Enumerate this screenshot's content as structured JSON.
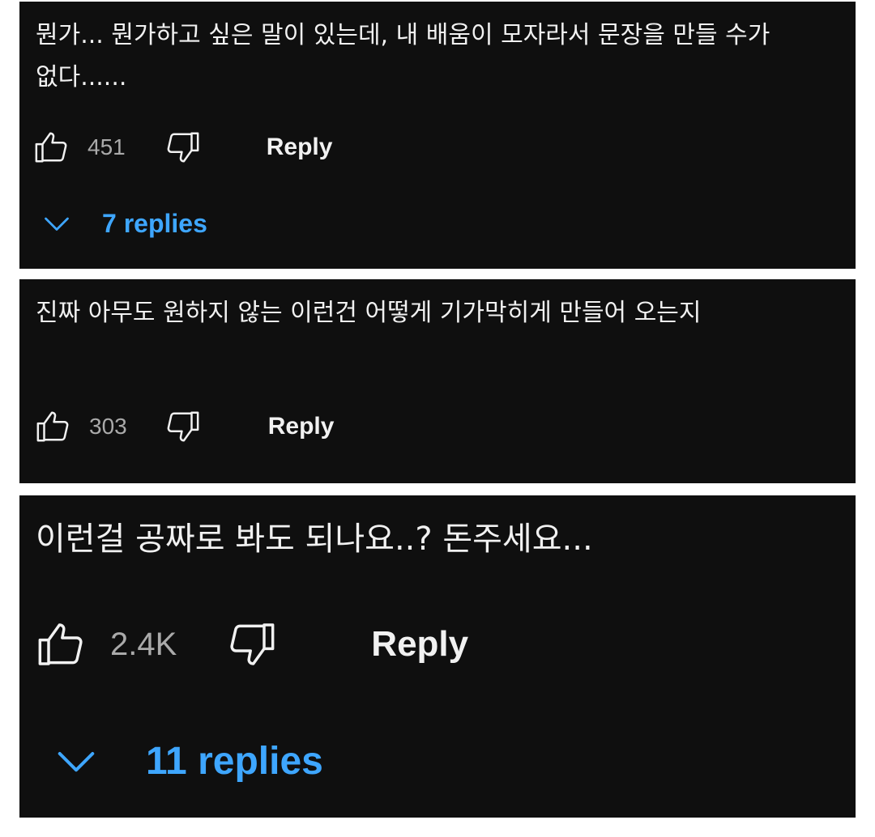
{
  "comments": [
    {
      "text": "뭔가... 뭔가하고 싶은 말이 있는데, 내 배움이 모자라서 문장을 만들 수가 없다......",
      "likes": "451",
      "reply_label": "Reply",
      "replies_label": "7 replies"
    },
    {
      "text": "진짜 아무도 원하지 않는 이런건 어떻게 기가막히게 만들어 오는지",
      "likes": "303",
      "reply_label": "Reply"
    },
    {
      "text": "이런걸 공짜로 봐도 되나요..? 돈주세요...",
      "likes": "2.4K",
      "reply_label": "Reply",
      "replies_label": "11 replies"
    }
  ],
  "icons": {
    "like": "thumbs-up-icon",
    "dislike": "thumbs-down-icon",
    "expand": "chevron-down-icon"
  },
  "colors": {
    "background": "#0f0f0f",
    "text": "#f1f1f1",
    "count": "#aaaaaa",
    "link": "#3ea6ff"
  }
}
